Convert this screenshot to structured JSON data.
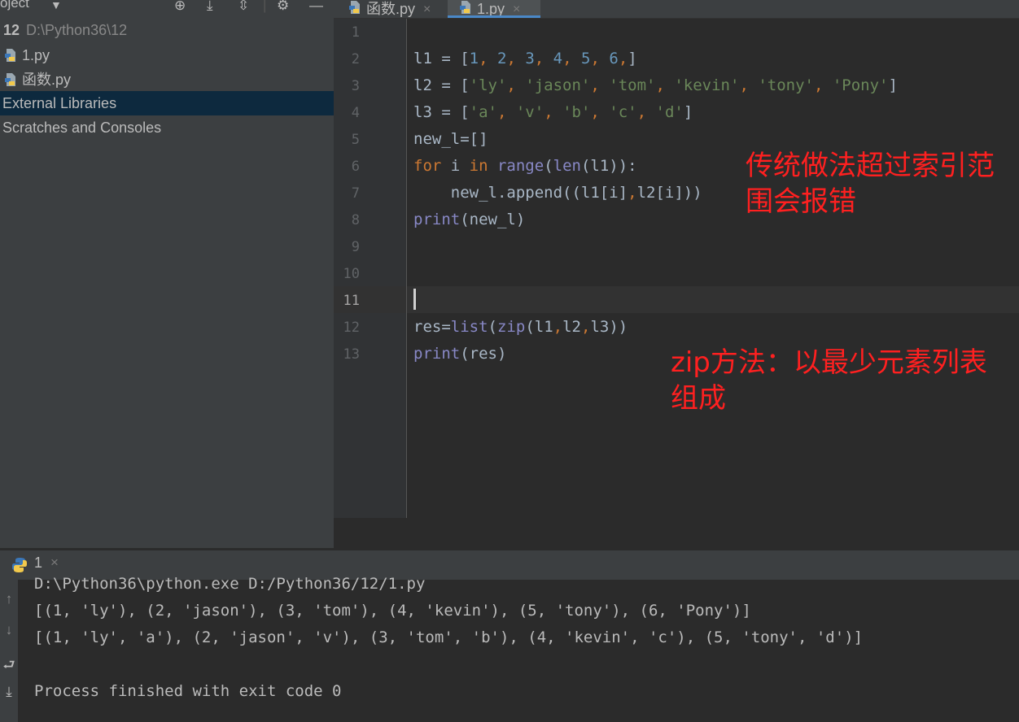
{
  "project_panel": {
    "title": "oject",
    "header_icons": [
      "target-icon",
      "collapse-all-icon",
      "expand-all-icon",
      "gear-icon",
      "minimize-icon"
    ],
    "root": {
      "name": "12",
      "path": "D:\\Python36\\12"
    },
    "files": [
      "1.py",
      "函数.py"
    ],
    "external_libraries": "External Libraries",
    "scratches": "Scratches and Consoles"
  },
  "tabs": [
    {
      "label": "函数.py",
      "close": "×",
      "active": false
    },
    {
      "label": "1.py",
      "close": "×",
      "active": true
    }
  ],
  "editor": {
    "line_numbers": [
      "1",
      "2",
      "3",
      "4",
      "5",
      "6",
      "7",
      "8",
      "9",
      "10",
      "11",
      "12",
      "13"
    ],
    "current_line": "11",
    "annotations": [
      {
        "line1": "传统做法超过索引范",
        "line2": "围会报错"
      },
      {
        "line1": "zip方法：以最少元素列表",
        "line2": "组成"
      }
    ]
  },
  "run_panel": {
    "tab_label": "1",
    "close": "×",
    "side_icons": [
      "up-arrow-icon",
      "down-arrow-icon",
      "soft-wrap-icon",
      "scroll-to-end-icon"
    ],
    "output": [
      "D:\\Python36\\python.exe D:/Python36/12/1.py",
      "[(1, 'ly'), (2, 'jason'), (3, 'tom'), (4, 'kevin'), (5, 'tony'), (6, 'Pony')]",
      "[(1, 'ly', 'a'), (2, 'jason', 'v'), (3, 'tom', 'b'), (4, 'kevin', 'c'), (5, 'tony', 'd')]",
      "",
      "Process finished with exit code 0"
    ]
  },
  "colors": {
    "annotation": "#ff2020",
    "keyword": "#cc7832",
    "number": "#6897bb",
    "string": "#6a8759",
    "builtin": "#8888c6",
    "selection": "#0d293e",
    "tab_underline": "#4a88c7"
  }
}
